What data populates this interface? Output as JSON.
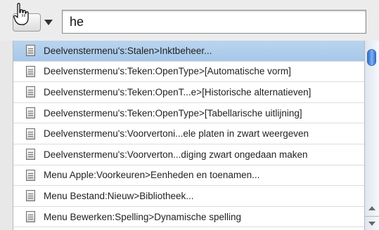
{
  "toolbar": {
    "quick_button_icon": "lightning-bolt-icon",
    "dropdown_icon": "triangle-down-icon",
    "cursor_icon": "pointing-hand-cursor-icon",
    "accent_color": "#e8a21a"
  },
  "search": {
    "value": "he"
  },
  "results": [
    {
      "label": "Deelvenstermenu's:Stalen>Inktbeheer...",
      "selected": true
    },
    {
      "label": "Deelvenstermenu's:Teken:OpenType>[Automatische vorm]"
    },
    {
      "label": "Deelvenstermenu's:Teken:OpenT...e>[Historische alternatieven]"
    },
    {
      "label": "Deelvenstermenu's:Teken:OpenType>[Tabellarische uitlijning]"
    },
    {
      "label": "Deelvenstermenu's:Voorvertoni...ele platen in zwart weergeven"
    },
    {
      "label": "Deelvenstermenu's:Voorverton...diging zwart ongedaan maken"
    },
    {
      "label": "Menu Apple:Voorkeuren>Eenheden en toenamen..."
    },
    {
      "label": "Menu Bestand:Nieuw>Bibliotheek..."
    },
    {
      "label": "Menu Bewerken:Spelling>Dynamische spelling"
    }
  ],
  "colors": {
    "selection": "#a7c8ea",
    "scroll_thumb": "#2a6fd0"
  }
}
